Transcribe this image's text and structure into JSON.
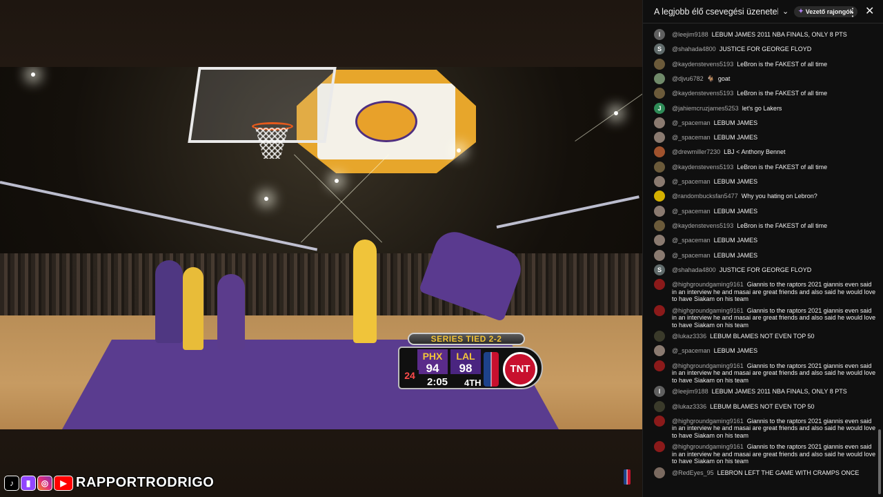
{
  "video": {
    "scoreboard": {
      "series_text": "SERIES TIED 2-2",
      "home_team": "PHX",
      "home_score": "94",
      "away_team": "LAL",
      "away_score": "98",
      "shot_clock": "24",
      "game_clock": "2:05",
      "quarter": "4TH",
      "network": "TNT"
    },
    "channel": {
      "name": "RAPPORTRODRIGO",
      "social_icons": [
        "tiktok-icon",
        "twitch-icon",
        "instagram-icon",
        "youtube-icon"
      ]
    }
  },
  "chat": {
    "title": "A legjobb élő csevegési üzenetek új…",
    "badge": "Vezető rajongók",
    "messages": [
      {
        "author": "@leejim9188",
        "text": "LEBUM JAMES 2011 NBA FINALS, ONLY 8 PTS",
        "avatar": "l",
        "color": "#606060"
      },
      {
        "author": "@shahada4800",
        "text": "JUSTICE FOR GEORGE FLOYD",
        "avatar": "S",
        "color": "#5f6a6a"
      },
      {
        "author": "@kaydenstevens5193",
        "text": "LeBron is the FAKEST of all time",
        "avatar": "",
        "color": "#6b5a3a"
      },
      {
        "author": "@djvu6782",
        "text": "goat",
        "avatar": "",
        "color": "#708a6a",
        "emoji": "🐐"
      },
      {
        "author": "@kaydenstevens5193",
        "text": "LeBron is the FAKEST of all time",
        "avatar": "",
        "color": "#6b5a3a"
      },
      {
        "author": "@jahiemcruzjames5253",
        "text": "let's go Lakers",
        "avatar": "J",
        "color": "#2e8b57"
      },
      {
        "author": "@_spaceman",
        "text": "LEBUM JAMES",
        "avatar": "",
        "color": "#8a7a70"
      },
      {
        "author": "@_spaceman",
        "text": "LEBUM JAMES",
        "avatar": "",
        "color": "#8a7a70"
      },
      {
        "author": "@drewmiller7230",
        "text": "LBJ < Anthony Bennet",
        "avatar": "",
        "color": "#a0522d"
      },
      {
        "author": "@kaydenstevens5193",
        "text": "LeBron is the FAKEST of all time",
        "avatar": "",
        "color": "#6b5a3a"
      },
      {
        "author": "@_spaceman",
        "text": "LEBUM JAMES",
        "avatar": "",
        "color": "#8a7a70"
      },
      {
        "author": "@randombucksfan5477",
        "text": "Why you hating on Lebron?",
        "avatar": "",
        "color": "#d4b000"
      },
      {
        "author": "@_spaceman",
        "text": "LEBUM JAMES",
        "avatar": "",
        "color": "#8a7a70"
      },
      {
        "author": "@kaydenstevens5193",
        "text": "LeBron is the FAKEST of all time",
        "avatar": "",
        "color": "#6b5a3a"
      },
      {
        "author": "@_spaceman",
        "text": "LEBUM JAMES",
        "avatar": "",
        "color": "#8a7a70"
      },
      {
        "author": "@_spaceman",
        "text": "LEBUM JAMES",
        "avatar": "",
        "color": "#8a7a70"
      },
      {
        "author": "@shahada4800",
        "text": "JUSTICE FOR GEORGE FLOYD",
        "avatar": "S",
        "color": "#5f6a6a"
      },
      {
        "author": "@highgroundgaming9161",
        "text": "Giannis to the raptors 2021 giannis even said in an interview he and masai are great friends and also said he would love to have Siakam on his team",
        "avatar": "",
        "color": "#8b1a1a"
      },
      {
        "author": "@highgroundgaming9161",
        "text": "Giannis to the raptors 2021 giannis even said in an interview he and masai are great friends and also said he would love to have Siakam on his team",
        "avatar": "",
        "color": "#8b1a1a"
      },
      {
        "author": "@lukaz3336",
        "text": "LEBUM BLAMES NOT EVEN TOP 50",
        "avatar": "",
        "color": "#3a3a2a"
      },
      {
        "author": "@_spaceman",
        "text": "LEBUM JAMES",
        "avatar": "",
        "color": "#8a7a70"
      },
      {
        "author": "@highgroundgaming9161",
        "text": "Giannis to the raptors 2021 giannis even said in an interview he and masai are great friends and also said he would love to have Siakam on his team",
        "avatar": "",
        "color": "#8b1a1a"
      },
      {
        "author": "@leejim9188",
        "text": "LEBUM JAMES 2011 NBA FINALS, ONLY 8 PTS",
        "avatar": "l",
        "color": "#606060"
      },
      {
        "author": "@lukaz3336",
        "text": "LEBUM BLAMES NOT EVEN TOP 50",
        "avatar": "",
        "color": "#3a3a2a"
      },
      {
        "author": "@highgroundgaming9161",
        "text": "Giannis to the raptors 2021 giannis even said in an interview he and masai are great friends and also said he would love to have Siakam on his team",
        "avatar": "",
        "color": "#8b1a1a"
      },
      {
        "author": "@highgroundgaming9161",
        "text": "Giannis to the raptors 2021 giannis even said in an interview he and masai are great friends and also said he would love to have Siakam on his team",
        "avatar": "",
        "color": "#8b1a1a"
      },
      {
        "author": "@RedEyes_95",
        "text": "LEBRON LEFT THE GAME WITH CRAMPS ONCE",
        "avatar": "",
        "color": "#7a6a60"
      }
    ]
  }
}
